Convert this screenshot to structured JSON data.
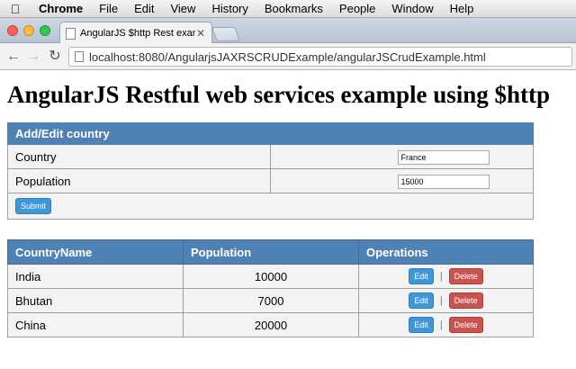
{
  "menubar": {
    "app": "Chrome",
    "items": [
      "File",
      "Edit",
      "View",
      "History",
      "Bookmarks",
      "People",
      "Window",
      "Help"
    ]
  },
  "browser": {
    "tab_title": "AngularJS $http Rest exam",
    "url": "localhost:8080/AngularjsJAXRSCRUDExample/angularJSCrudExample.html"
  },
  "page": {
    "heading": "AngularJS Restful web services example using $http",
    "form": {
      "header": "Add/Edit country",
      "country_label": "Country",
      "country_value": "France",
      "population_label": "Population",
      "population_value": "15000",
      "submit_label": "Submit"
    },
    "table": {
      "headers": [
        "CountryName",
        "Population",
        "Operations"
      ],
      "rows": [
        {
          "name": "India",
          "population": "10000"
        },
        {
          "name": "Bhutan",
          "population": "7000"
        },
        {
          "name": "China",
          "population": "20000"
        }
      ],
      "edit_label": "Edit",
      "delete_label": "Delete",
      "separator": "|"
    }
  },
  "colors": {
    "header_blue": "#4f81b5",
    "edit_blue": "#3f97d8",
    "delete_red": "#c9534f"
  }
}
